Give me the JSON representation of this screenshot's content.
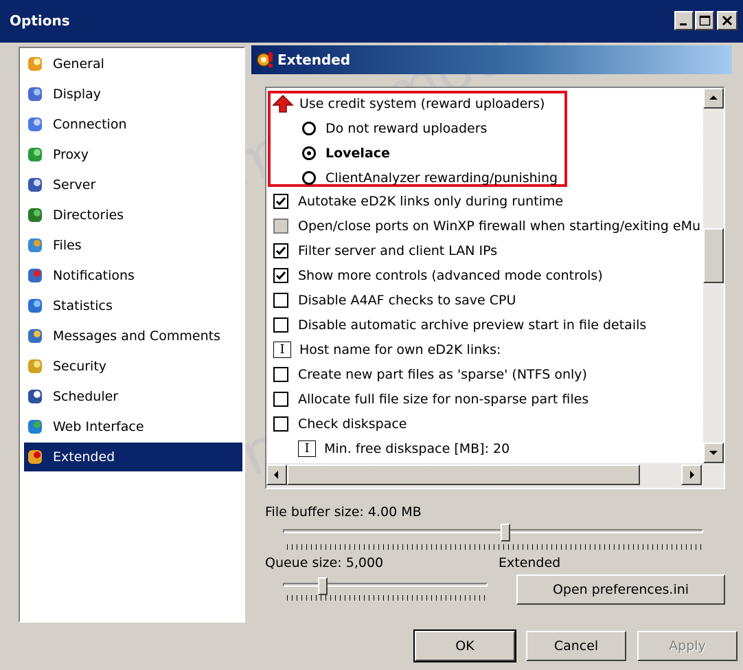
{
  "window": {
    "title": "Options"
  },
  "nav": {
    "items": [
      {
        "label": "General",
        "icon": "general-icon"
      },
      {
        "label": "Display",
        "icon": "display-icon"
      },
      {
        "label": "Connection",
        "icon": "connection-icon"
      },
      {
        "label": "Proxy",
        "icon": "proxy-icon"
      },
      {
        "label": "Server",
        "icon": "server-icon"
      },
      {
        "label": "Directories",
        "icon": "directories-icon"
      },
      {
        "label": "Files",
        "icon": "files-icon"
      },
      {
        "label": "Notifications",
        "icon": "notifications-icon"
      },
      {
        "label": "Statistics",
        "icon": "statistics-icon"
      },
      {
        "label": "Messages and Comments",
        "icon": "messages-icon"
      },
      {
        "label": "Security",
        "icon": "lock-icon"
      },
      {
        "label": "Scheduler",
        "icon": "calendar-icon"
      },
      {
        "label": "Web Interface",
        "icon": "globe-icon"
      },
      {
        "label": "Extended",
        "icon": "extended-icon",
        "selected": true
      }
    ]
  },
  "panel": {
    "title": "Extended"
  },
  "tree": {
    "credit_system": "Use credit system (reward uploaders)",
    "options": [
      {
        "label": "Do not reward uploaders",
        "selected": false
      },
      {
        "label": "Lovelace",
        "selected": true
      },
      {
        "label": "ClientAnalyzer rewarding/punishing",
        "selected": false
      }
    ],
    "items": [
      {
        "label": "Autotake eD2K links only during runtime",
        "type": "checkbox",
        "checked": true
      },
      {
        "label": "Open/close ports on WinXP firewall when starting/exiting eMu",
        "type": "checkbox",
        "checked": false,
        "disabled": true
      },
      {
        "label": "Filter server and client LAN IPs",
        "type": "checkbox",
        "checked": true
      },
      {
        "label": "Show more controls (advanced mode controls)",
        "type": "checkbox",
        "checked": true
      },
      {
        "label": "Disable A4AF checks to save CPU",
        "type": "checkbox",
        "checked": false
      },
      {
        "label": "Disable automatic archive preview start in file details",
        "type": "checkbox",
        "checked": false
      },
      {
        "label": "Host name for own eD2K links:",
        "type": "edit"
      },
      {
        "label": "Create new part files as 'sparse' (NTFS only)",
        "type": "checkbox",
        "checked": false
      },
      {
        "label": "Allocate full file size for non-sparse part files",
        "type": "checkbox",
        "checked": false
      },
      {
        "label": "Check diskspace",
        "type": "checkbox",
        "checked": false
      },
      {
        "label": "Min. free diskspace [MB]: 20",
        "type": "edit",
        "indent": true
      }
    ]
  },
  "file_buffer": {
    "label": "File buffer size: 4.00 MB",
    "position": 0.53
  },
  "queue_size": {
    "label": "Queue size: 5,000",
    "position": 0.18
  },
  "extended_label": "Extended",
  "buttons": {
    "open_prefs": "Open preferences.ini",
    "ok": "OK",
    "cancel": "Cancel",
    "apply": "Apply"
  },
  "watermark": "www.emule-mods.it"
}
